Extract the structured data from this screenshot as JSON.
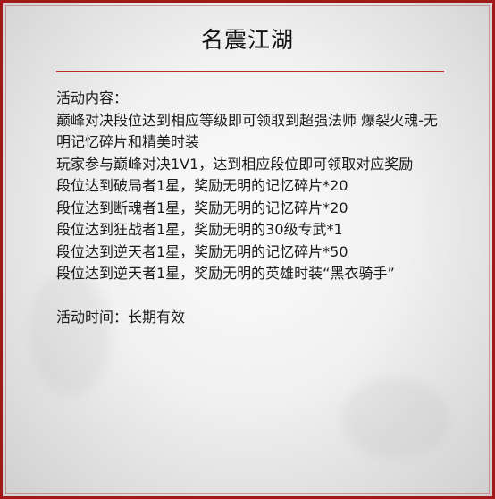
{
  "title": "名震江湖",
  "colors": {
    "border": "#a11a1a",
    "rule": "#c0282d",
    "text": "#1a1a1a"
  },
  "content": {
    "heading": "活动内容：",
    "desc1": "巅峰对决段位达到相应等级即可领取到超强法师 爆裂火魂-无明记忆碎片和精美时装",
    "desc2": "玩家参与巅峰对决1V1，达到相应段位即可领取对应奖励",
    "rewards": [
      "段位达到破局者1星，奖励无明的记忆碎片*20",
      "段位达到断魂者1星，奖励无明的记忆碎片*20",
      "段位达到狂战者1星，奖励无明的30级专武*1",
      "段位达到逆天者1星，奖励无明的记忆碎片*50",
      "段位达到逆天者1星，奖励无明的英雄时装“黑衣骑手”"
    ],
    "time": "活动时间：长期有效"
  }
}
